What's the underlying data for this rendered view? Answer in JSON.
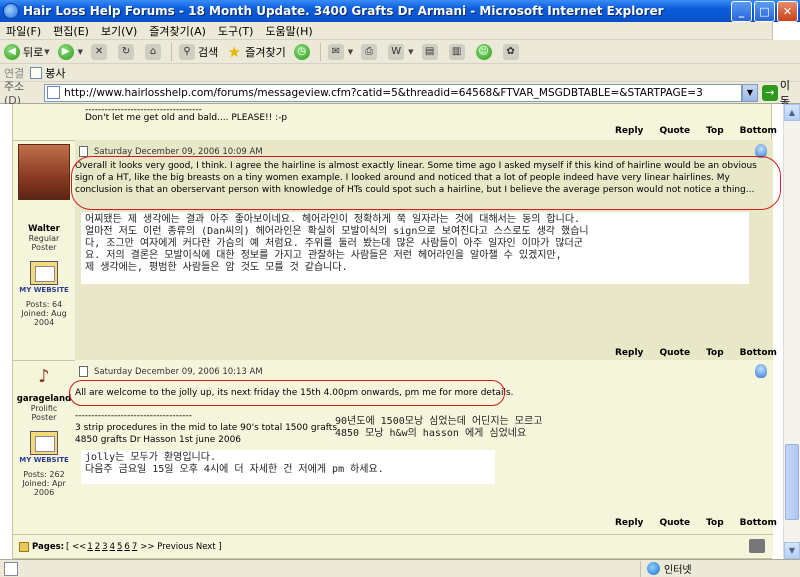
{
  "window": {
    "title": "Hair Loss Help Forums - 18 Month Update. 3400 Grafts Dr Armani - Microsoft Internet Explorer"
  },
  "menu": [
    "파일(F)",
    "편집(E)",
    "보기(V)",
    "즐겨찾기(A)",
    "도구(T)",
    "도움말(H)"
  ],
  "toolbar": {
    "back": "뒤로",
    "search": "검색",
    "favorites": "즐겨찾기"
  },
  "links": {
    "label": "연결",
    "item": "봉사"
  },
  "address": {
    "label": "주소(D)",
    "url": "http://www.hairlosshelp.com/forums/messageview.cfm?catid=5&threadid=64568&FTVAR_MSGDBTABLE=&STARTPAGE=3",
    "go": "이동"
  },
  "actions": {
    "reply": "Reply",
    "quote": "Quote",
    "top": "Top",
    "bottom": "Bottom"
  },
  "top_fragment": {
    "dashes": "------------------------------------",
    "text": "Don't let me get old and bald.... PLEASE!! :-p"
  },
  "post1": {
    "author": "Walter",
    "rank": [
      "Regular",
      "Poster"
    ],
    "website": "MY WEBSITE",
    "posts": "Posts: 64",
    "joined": [
      "Joined: Aug",
      "2004"
    ],
    "date": "Saturday December 09, 2006 10:09 AM",
    "body": "Overall it looks very good, I think. I agree the hairline is almost exactly linear. Some time ago I asked myself if this kind of hairline would be an obvious sign of a HT, like the big breasts on a tiny women example. I looked around and noticed that a lot of people indeed have very linear hairlines. My conclusion is that an oberservant person with knowledge of HTs could spot such a hairline, but I believe the average person would not notice a thing...",
    "korean": "어찌됐든 제 생각에는 결과 아주 좋아보이네요. 헤어라인이 정확하게 쭉 일자라는 것에 대해서는 동의 합니다.\n얼마전 저도 이런 종류의 (Dan씨의) 헤어라인은 확실히 모발이식의 sign으로 보여진다고 스스로도 생각 했습니\n다, 조그만 여자에게 커다란 가슴의 예 처럼요. 주위를 둘러 봤는데 많은 사람들이 아주 일자인 이마가 많더군\n요. 저의 결론은 모발이식에 대한 정보를 가지고 관찰하는 사람들은 저런 헤어라인을 알아챌 수 있겠지만,\n제 생각에는, 평범한 사람들은 암 것도 모를 것 같습니다."
  },
  "post2": {
    "author": "garageland",
    "rank": [
      "Prolific",
      "Poster"
    ],
    "website": "MY WEBSITE",
    "posts": "Posts: 262",
    "joined": [
      "Joined: Apr",
      "2006"
    ],
    "date": "Saturday December 09, 2006 10:13 AM",
    "body": "All are welcome to the jolly up, its next friday the 15th 4.00pm onwards, pm me for more details.",
    "dashes": "------------------------------------",
    "sig1": "3 strip procedures in the mid to late 90's total 1500 grafts",
    "sig2": "4850 grafts Dr Hasson 1st june 2006",
    "note": "90년도에 1500모낭 심었는데 어딘지는 모르고\n4850 모낭 h&w의 hasson 에게 심었네요",
    "korean": "jolly는 모두가 환영입니다.\n다음주 금요일 15일 오후 4시에 더 자세한 건 저에게 pm 하세요."
  },
  "pages": {
    "label": "Pages:",
    "prefix": "[ <<",
    "nums": [
      "1",
      "2",
      "3",
      "4",
      "5",
      "6",
      "7"
    ],
    "suffix": ">> Previous Next ]"
  },
  "status": {
    "zone": "인터넷"
  }
}
